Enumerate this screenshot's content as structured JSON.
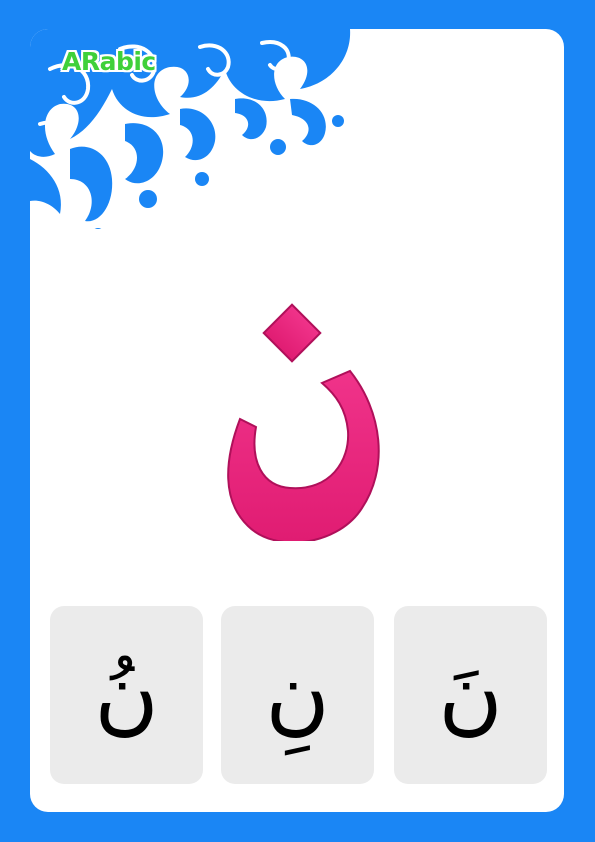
{
  "brand": {
    "label": "ARabic"
  },
  "letter": {
    "glyph": "ن",
    "color": "#e8207a"
  },
  "tiles": [
    {
      "glyph": "نُ",
      "vowel": "damma"
    },
    {
      "glyph": "نِ",
      "vowel": "kasra"
    },
    {
      "glyph": "نَ",
      "vowel": "fatha"
    }
  ],
  "colors": {
    "frame": "#1a86f5",
    "ornament": "#1a86f5",
    "brand": "#3fd03a",
    "tile": "#ebebeb"
  }
}
